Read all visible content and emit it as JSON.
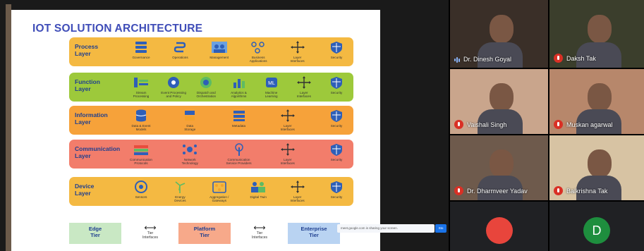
{
  "slide": {
    "title": "IOT SOLUTION ARCHITECTURE",
    "layers": [
      {
        "name": "Process\nLayer",
        "color": "#f4b942",
        "text_color": "#1f3f8f",
        "items": [
          {
            "label": "Governance",
            "icon": "stack-icon"
          },
          {
            "label": "Operations",
            "icon": "flow-icon"
          },
          {
            "label": "Management",
            "icon": "people-icon"
          },
          {
            "label": "Business\nApplications",
            "icon": "nodes-icon"
          },
          {
            "label": "Layer\nInterfaces",
            "icon": "cross-arrows-icon"
          },
          {
            "label": "Security",
            "icon": "shield-icon"
          }
        ]
      },
      {
        "name": "Function\nLayer",
        "color": "#9dc93b",
        "text_color": "#1f3f8f",
        "items": [
          {
            "label": "Stream\nProcessing",
            "icon": "stream-icon"
          },
          {
            "label": "Event Processing\nand Policy",
            "icon": "gear-icon"
          },
          {
            "label": "Dispatch and\nOrchestration",
            "icon": "dispatch-icon"
          },
          {
            "label": "Analytics &\nAlgorithms",
            "icon": "analytics-icon"
          },
          {
            "label": "Machine\nLearning",
            "icon": "ml-icon"
          },
          {
            "label": "Layer\nInterfaces",
            "icon": "cross-arrows-icon"
          },
          {
            "label": "Security",
            "icon": "shield-icon"
          }
        ]
      },
      {
        "name": "Information\nLayer",
        "color": "#f6a23a",
        "text_color": "#1f3f8f",
        "items": [
          {
            "label": "Data & Event\nModels",
            "icon": "database-icon"
          },
          {
            "label": "Data\nStorage",
            "icon": "storage-icon"
          },
          {
            "label": "Metadata",
            "icon": "metadata-icon"
          },
          {
            "label": "Layer\nInterfaces",
            "icon": "cross-arrows-icon"
          },
          {
            "label": "Security",
            "icon": "shield-icon"
          }
        ]
      },
      {
        "name": "Communication\nLayer",
        "color": "#f27d6b",
        "text_color": "#1f3f8f",
        "items": [
          {
            "label": "Communication\nProtocols",
            "icon": "protocols-icon"
          },
          {
            "label": "Network\nTechnology",
            "icon": "network-icon"
          },
          {
            "label": "Communication\nService Providers",
            "icon": "antenna-icon"
          },
          {
            "label": "Layer\nInterfaces",
            "icon": "cross-arrows-icon"
          },
          {
            "label": "Security",
            "icon": "shield-icon"
          }
        ]
      },
      {
        "name": "Device\nLayer",
        "color": "#f4b942",
        "text_color": "#1f3f8f",
        "items": [
          {
            "label": "Sensors",
            "icon": "sensor-icon"
          },
          {
            "label": "Energy\nDevices",
            "icon": "wind-turbine-icon"
          },
          {
            "label": "Aggregation /\nGateways",
            "icon": "gateway-icon"
          },
          {
            "label": "Digital Twin",
            "icon": "twin-icon"
          },
          {
            "label": "Layer\nInterfaces",
            "icon": "cross-arrows-icon"
          },
          {
            "label": "Security",
            "icon": "shield-icon"
          }
        ]
      }
    ],
    "tiers": [
      {
        "label": "Edge\nTier",
        "color": "#c9e8c4"
      },
      {
        "label": "Platform\nTier",
        "color": "#f7a98a"
      },
      {
        "label": "Enterprise\nTier",
        "color": "#b9d3f2"
      }
    ],
    "tier_link_label": "Tier\nInterfaces"
  },
  "share_notice": {
    "text": "meet.google.com is sharing your screen.",
    "button": "Sto"
  },
  "participants": [
    {
      "name": "Dr. Dinesh Goyal",
      "muted": false,
      "bg": "#3a2f28"
    },
    {
      "name": "Daksh Tak",
      "muted": true,
      "bg": "#3b3e2c"
    },
    {
      "name": "Vaishali Singh",
      "muted": true,
      "bg": "#c9a58c"
    },
    {
      "name": "Muskan agarwal",
      "muted": true,
      "bg": "#b7876b"
    },
    {
      "name": "Dr. Dharmveer Yadav",
      "muted": true,
      "bg": "#6e5a4c"
    },
    {
      "name": "Balkrishna Tak",
      "muted": true,
      "bg": "#d7c3a3"
    },
    {
      "name": "",
      "muted": false,
      "bg": "#202124",
      "avatar_color": "#e8453c"
    },
    {
      "name": "",
      "muted": false,
      "bg": "#202124",
      "avatar_letter": "D",
      "avatar_color": "#1e8e3e"
    }
  ]
}
